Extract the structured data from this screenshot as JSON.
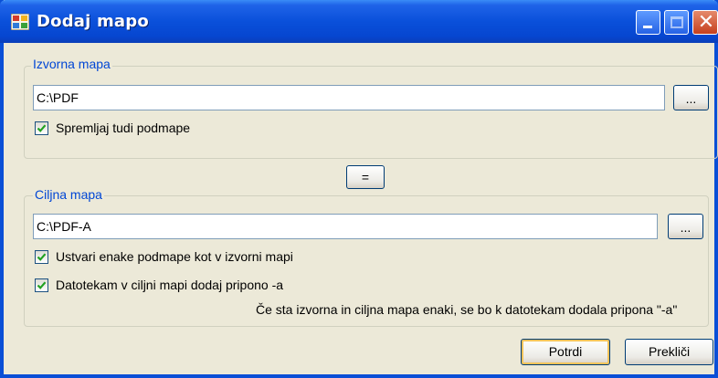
{
  "window": {
    "title": "Dodaj mapo"
  },
  "source_group": {
    "legend": "Izvorna mapa",
    "path_value": "C:\\PDF",
    "browse_label": "...",
    "include_subfolders": {
      "label": "Spremljaj tudi podmape",
      "checked": true
    }
  },
  "equal_button_label": "=",
  "target_group": {
    "legend": "Ciljna mapa",
    "path_value": "C:\\PDF-A",
    "browse_label": "...",
    "create_subfolders": {
      "label": "Ustvari enake podmape kot v izvorni mapi",
      "checked": true
    },
    "add_suffix": {
      "label": "Datotekam v ciljni mapi dodaj pripono -a",
      "checked": true
    },
    "note": "Če sta izvorna in ciljna mapa enaki, se bo k datotekam dodala pripona \"-a\""
  },
  "buttons": {
    "ok": "Potrdi",
    "cancel": "Prekliči"
  },
  "colors": {
    "titlebar": "#0a50da",
    "legend_text": "#0046d5",
    "dialog_bg": "#ece9d8",
    "check": "#21a121"
  }
}
